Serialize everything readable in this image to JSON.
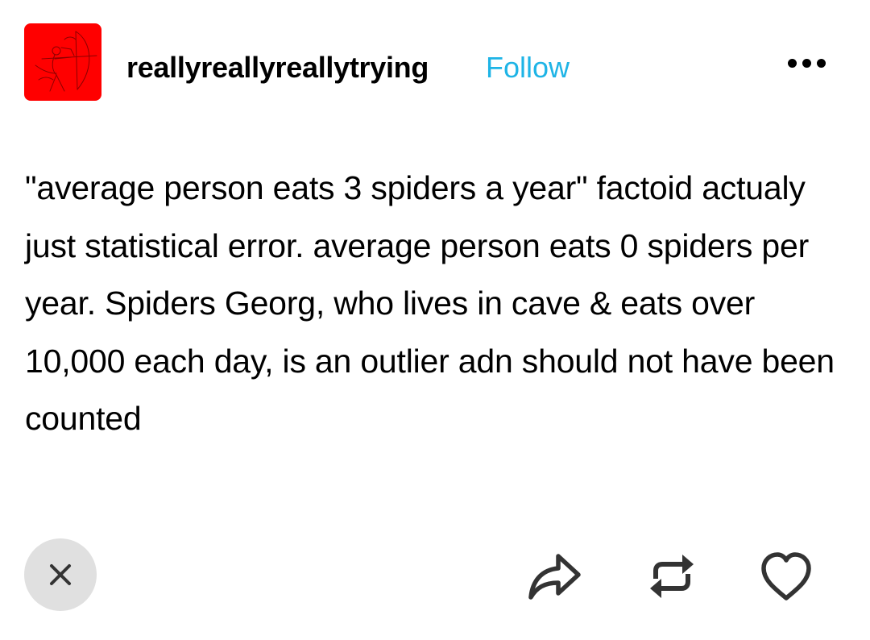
{
  "post": {
    "username": "reallyreallyreallytrying",
    "follow_label": "Follow",
    "text": "\"average person eats 3 spiders a year\" factoid actualy just statistical error. average person eats 0 spiders per year. Spiders Georg, who lives in cave & eats over 10,000 each day, is an outlier adn should not have been counted"
  },
  "icons": {
    "avatar": "archer-drawing-avatar",
    "more": "more-options-icon",
    "close": "close-icon",
    "share": "share-icon",
    "reblog": "reblog-icon",
    "like": "heart-icon"
  },
  "colors": {
    "avatar_bg": "#ff0000",
    "follow": "#1eb4e6",
    "close_bg": "#e0e0e0",
    "icon": "#333333",
    "text": "#000000"
  }
}
